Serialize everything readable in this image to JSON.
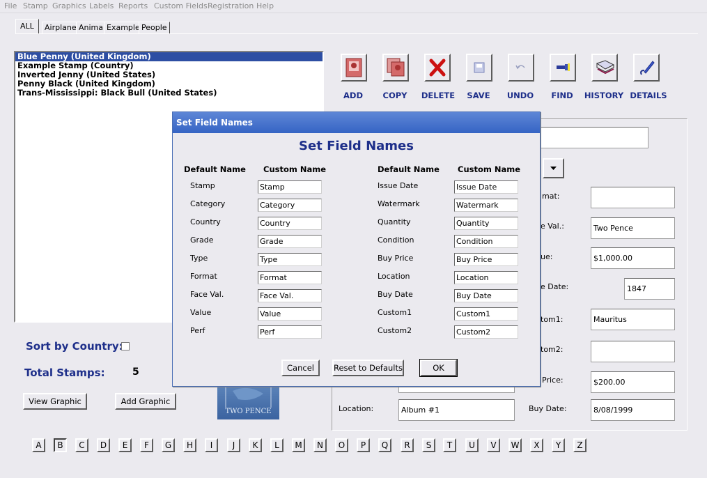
{
  "menu": [
    "File",
    "Stamp",
    "Graphics",
    "Labels",
    "Reports",
    "Custom Fields",
    "Registration",
    "Help"
  ],
  "tabs": [
    "ALL",
    "Airplane",
    "Animal",
    "Example",
    "People"
  ],
  "stamp_list": [
    "Blue Penny (United Kingdom)",
    "Example Stamp (Country)",
    "Inverted Jenny (United States)",
    "Penny Black (United Kingdom)",
    "Trans-Mississippi: Black Bull (United States)"
  ],
  "toolbar": {
    "add": "ADD",
    "copy": "COPY",
    "delete": "DELETE",
    "save": "SAVE",
    "undo": "UNDO",
    "find": "FIND",
    "history": "HISTORY",
    "details": "DETAILS"
  },
  "left": {
    "sort_label": "Sort by Country:",
    "total_label": "Total Stamps:",
    "total_value": "5",
    "view_graphic": "View Graphic",
    "add_graphic": "Add Graphic",
    "stamp_image_text": "TWO PENCE"
  },
  "details": {
    "format_label": "mat:",
    "face_val_label": "e Val.:",
    "face_val": "Two Pence",
    "value_label": "ue:",
    "value": "$1,000.00",
    "issue_date_label": "e Date:",
    "issue_date": "1847",
    "custom1_label": "tom1:",
    "custom1": "Mauritus",
    "custom2_label": "tom2:",
    "buy_price_label": "Price:",
    "buy_price": "$200.00",
    "location_label": "Location:",
    "location": "Album #1",
    "buy_date_label": "Buy Date:",
    "buy_date": "8/08/1999"
  },
  "alphabet": [
    "A",
    "B",
    "C",
    "D",
    "E",
    "F",
    "G",
    "H",
    "I",
    "J",
    "K",
    "L",
    "M",
    "N",
    "O",
    "P",
    "Q",
    "R",
    "S",
    "T",
    "U",
    "V",
    "W",
    "X",
    "Y",
    "Z"
  ],
  "dialog": {
    "title": "Set Field Names",
    "heading": "Set Field Names",
    "col_default": "Default Name",
    "col_custom": "Custom Name",
    "left_fields": [
      {
        "default": "Stamp",
        "custom": "Stamp"
      },
      {
        "default": "Category",
        "custom": "Category"
      },
      {
        "default": "Country",
        "custom": "Country"
      },
      {
        "default": "Grade",
        "custom": "Grade"
      },
      {
        "default": "Type",
        "custom": "Type"
      },
      {
        "default": "Format",
        "custom": "Format"
      },
      {
        "default": "Face Val.",
        "custom": "Face Val."
      },
      {
        "default": "Value",
        "custom": "Value"
      },
      {
        "default": "Perf",
        "custom": "Perf"
      }
    ],
    "right_fields": [
      {
        "default": "Issue Date",
        "custom": "Issue Date"
      },
      {
        "default": "Watermark",
        "custom": "Watermark"
      },
      {
        "default": "Quantity",
        "custom": "Quantity"
      },
      {
        "default": "Condition",
        "custom": "Condition"
      },
      {
        "default": "Buy Price",
        "custom": "Buy Price"
      },
      {
        "default": "Location",
        "custom": "Location"
      },
      {
        "default": "Buy Date",
        "custom": "Buy Date"
      },
      {
        "default": "Custom1",
        "custom": "Custom1"
      },
      {
        "default": "Custom2",
        "custom": "Custom2"
      }
    ],
    "cancel": "Cancel",
    "reset": "Reset to Defaults",
    "ok": "OK"
  }
}
